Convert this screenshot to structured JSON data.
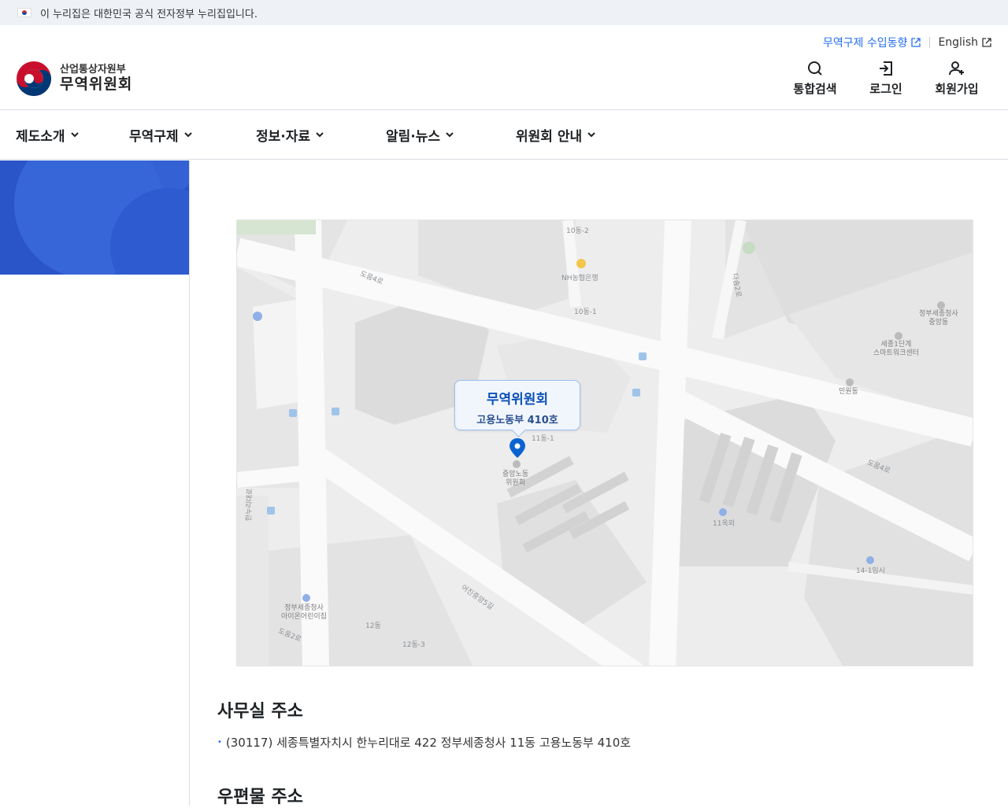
{
  "gov_banner": {
    "text": "이 누리집은 대한민국 공식 전자정부 누리집입니다."
  },
  "logo": {
    "ministry": "산업통상자원부",
    "name": "무역위원회"
  },
  "util": {
    "trade_remedy_status": "무역구제 수입동향",
    "english": "English"
  },
  "user_actions": {
    "search": "통합검색",
    "login": "로그인",
    "signup": "회원가입"
  },
  "gnb": [
    {
      "label": "제도소개"
    },
    {
      "label": "무역구제"
    },
    {
      "label": "정보·자료"
    },
    {
      "label": "알림·뉴스"
    },
    {
      "label": "위원회 안내"
    }
  ],
  "map": {
    "callout_title": "무역위원회",
    "callout_sub": "고용노동부 410호",
    "labels": {
      "b10_2": "10동-2",
      "nh": "NH농협은행",
      "b10_1": "10동-1",
      "doum4_a": "도움4로",
      "dasom2": "다솜2로",
      "gov_central": "정부세종청사\n중앙동",
      "smartwork": "세종1단계\n스마트워크센터",
      "minwon": "민원동",
      "b11_1": "11동-1",
      "labor_comm": "중앙노동\n위원회",
      "doum4_b": "도움4로",
      "lot11": "11옥외",
      "lot14": "14-1임시",
      "hannuri": "한누리대로",
      "eojin5": "어진중앙5길",
      "daycare": "정부세종청사\n아이온어린이집",
      "b12": "12동",
      "b12_3": "12동-3",
      "doum2": "도움2로"
    }
  },
  "office_address": {
    "title": "사무실 주소",
    "address": "(30117) 세종특별자치시 한누리대로 422 정부세종청사 11동 고용노동부 410호"
  },
  "postal_address": {
    "title": "우편물 주소"
  }
}
